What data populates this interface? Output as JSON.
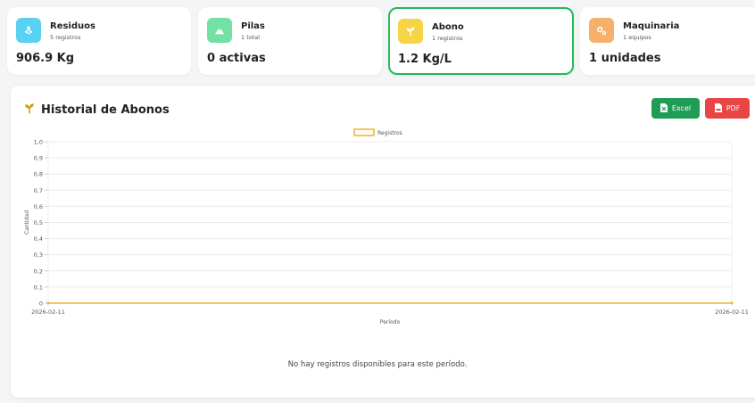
{
  "colors": {
    "residuos": "#5ad1f2",
    "pilas": "#73e0a4",
    "abono": "#f5d445",
    "maquinaria": "#f5b06b",
    "active_border": "#22bb55",
    "line": "#f0b429",
    "excel": "#1f9d55",
    "pdf": "#e84545"
  },
  "cards": [
    {
      "title": "Residuos",
      "subtitle": "5 registros",
      "value": "906.9 Kg",
      "icon": "recycle-icon"
    },
    {
      "title": "Pilas",
      "subtitle": "1 total",
      "value": "0 activas",
      "icon": "mountain-icon"
    },
    {
      "title": "Abono",
      "subtitle": "1 registros",
      "value": "1.2 Kg/L",
      "icon": "seedling-icon"
    },
    {
      "title": "Maquinaria",
      "subtitle": "1 equipos",
      "value": "1 unidades",
      "icon": "gears-icon"
    }
  ],
  "panel": {
    "title": "Historial de Abonos",
    "title_icon": "seedling-icon",
    "excel_label": "Excel",
    "pdf_label": "PDF"
  },
  "chart_data": {
    "type": "line",
    "x": [
      "2026-02-11",
      "2026-02-11"
    ],
    "series": [
      {
        "name": "Registros",
        "values": [
          0,
          0
        ]
      }
    ],
    "xlabel": "Período",
    "ylabel": "Cantidad",
    "ylim": [
      0,
      1
    ],
    "yticks": [
      "1,0",
      "0,9",
      "0,8",
      "0,7",
      "0,6",
      "0,5",
      "0,4",
      "0,3",
      "0,2",
      "0,1",
      "0"
    ],
    "legend": "top",
    "grid": true
  },
  "empty_message": "No hay registros disponibles para este período."
}
